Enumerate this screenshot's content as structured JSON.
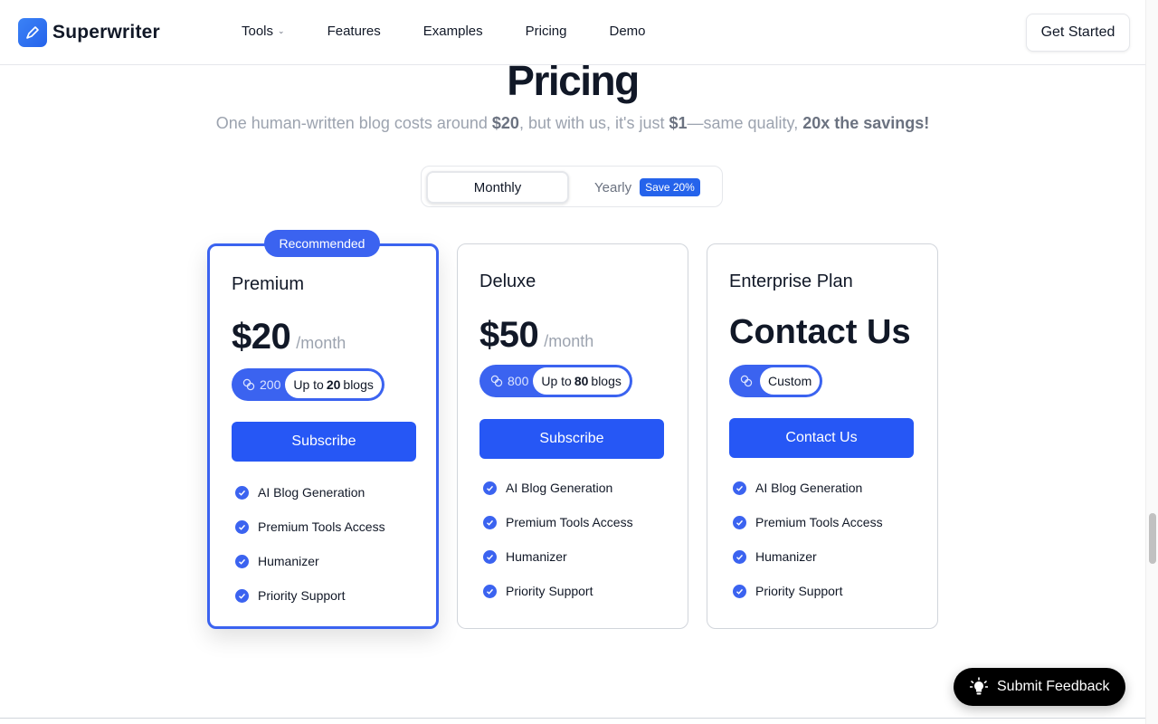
{
  "nav": {
    "logo_text": "Superwriter",
    "links": [
      {
        "label": "Tools",
        "has_dropdown": true,
        "dropdown_icon": "chevron-down-icon"
      },
      {
        "label": "Features"
      },
      {
        "label": "Examples"
      },
      {
        "label": "Pricing"
      },
      {
        "label": "Demo"
      }
    ],
    "cta": "Get Started"
  },
  "pricing": {
    "title": "Pricing",
    "subtitle": {
      "t1": "One human-written blog costs around ",
      "b1": "$20",
      "t2": ", but with us, it's just ",
      "b2": "$1",
      "t3": "—same quality, ",
      "b3": "20x the savings!"
    },
    "toggle": {
      "monthly": "Monthly",
      "yearly": "Yearly",
      "save_badge": "Save 20%",
      "selected": "Monthly"
    },
    "recommended_label": "Recommended",
    "plans": [
      {
        "name": "Premium",
        "price": "$20",
        "period": "/month",
        "credits": "200",
        "blogs_prefix": "Up to",
        "blogs_count": "20",
        "blogs_suffix": "blogs",
        "button": "Subscribe",
        "features": [
          "AI Blog Generation",
          "Premium Tools Access",
          "Humanizer",
          "Priority Support"
        ]
      },
      {
        "name": "Deluxe",
        "price": "$50",
        "period": "/month",
        "credits": "800",
        "blogs_prefix": "Up to",
        "blogs_count": "80",
        "blogs_suffix": "blogs",
        "button": "Subscribe",
        "features": [
          "AI Blog Generation",
          "Premium Tools Access",
          "Humanizer",
          "Priority Support"
        ]
      },
      {
        "name": "Enterprise Plan",
        "price": "Contact Us",
        "credits_label": "Custom",
        "button": "Contact Us",
        "features": [
          "AI Blog Generation",
          "Premium Tools Access",
          "Humanizer",
          "Priority Support"
        ]
      }
    ]
  },
  "feedback": {
    "label": "Submit Feedback",
    "icon": "lightbulb-icon"
  },
  "colors": {
    "accent": "#2657f5",
    "card_highlight": "#3b63f0",
    "feedback_bg": "#000000"
  }
}
